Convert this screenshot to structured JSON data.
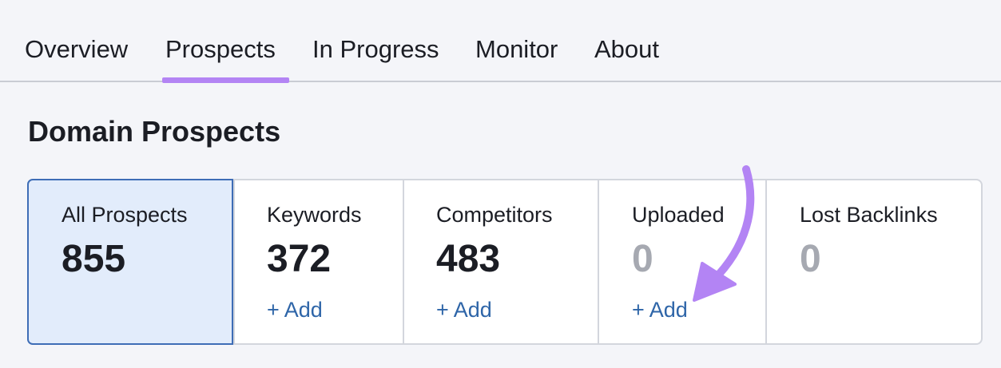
{
  "tabs": [
    {
      "label": "Overview"
    },
    {
      "label": "Prospects"
    },
    {
      "label": "In Progress"
    },
    {
      "label": "Monitor"
    },
    {
      "label": "About"
    }
  ],
  "active_tab": "Prospects",
  "page_title": "Domain Prospects",
  "cards": [
    {
      "label": "All Prospects",
      "value": "855",
      "add": ""
    },
    {
      "label": "Keywords",
      "value": "372",
      "add": "+ Add"
    },
    {
      "label": "Competitors",
      "value": "483",
      "add": "+ Add"
    },
    {
      "label": "Uploaded",
      "value": "0",
      "add": "+ Add"
    },
    {
      "label": "Lost Backlinks",
      "value": "0",
      "add": ""
    }
  ],
  "colors": {
    "accent_underline": "#b384f4",
    "annotation_arrow": "#b384f4",
    "active_card_bg": "#e2ecfb",
    "active_card_border": "#3e6db6",
    "link": "#2e65a8",
    "zero_value": "#a6a9b1"
  }
}
